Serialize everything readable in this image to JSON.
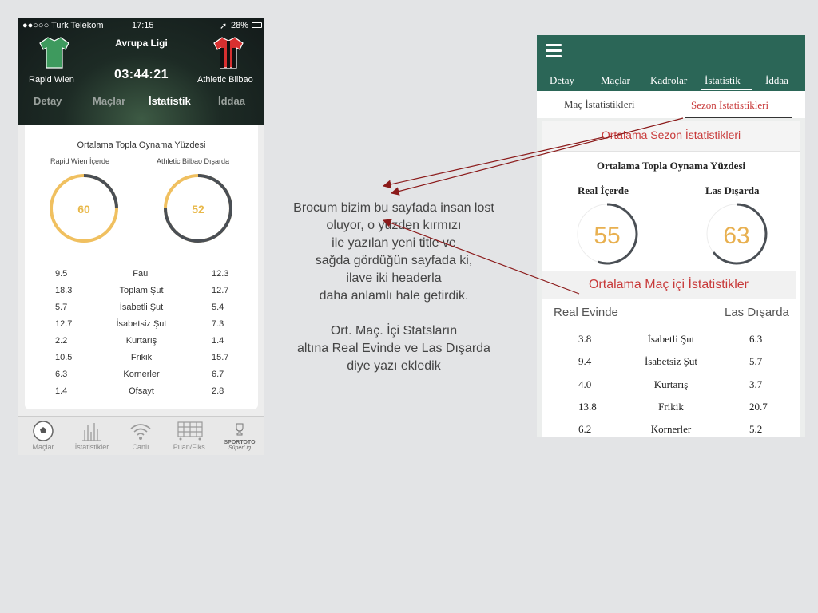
{
  "left_phone": {
    "status": {
      "carrier": "●●○○○ Turk Telekom",
      "time": "17:15",
      "battery": "28%"
    },
    "league": "Avrupa Ligi",
    "match_time": "03:44:21",
    "home_team": "Rapid Wien",
    "away_team": "Athletic Bilbao",
    "tabs": [
      "Detay",
      "Maçlar",
      "İstatistik",
      "İddaa"
    ],
    "active_tab": "İstatistik",
    "card": {
      "title": "Ortalama Topla Oynama Yüzdesi",
      "home_label": "Rapid Wien İçerde",
      "away_label": "Athletic Bilbao Dışarda",
      "home_possession": "60",
      "away_possession": "52",
      "rows": [
        {
          "home": "9.5",
          "label": "Faul",
          "away": "12.3"
        },
        {
          "home": "18.3",
          "label": "Toplam Şut",
          "away": "12.7"
        },
        {
          "home": "5.7",
          "label": "İsabetli Şut",
          "away": "5.4"
        },
        {
          "home": "12.7",
          "label": "İsabetsiz Şut",
          "away": "7.3"
        },
        {
          "home": "2.2",
          "label": "Kurtarış",
          "away": "1.4"
        },
        {
          "home": "10.5",
          "label": "Frikik",
          "away": "15.7"
        },
        {
          "home": "6.3",
          "label": "Kornerler",
          "away": "6.7"
        },
        {
          "home": "1.4",
          "label": "Ofsayt",
          "away": "2.8"
        }
      ]
    },
    "bottom_tabs": [
      "Maçlar",
      "İstatistikler",
      "Canlı",
      "Puan/Fiks."
    ],
    "sponsor": {
      "line1": "SPORTOTO",
      "line2": "SüperLig"
    }
  },
  "annotation": {
    "para1": [
      "Brocum bizim bu sayfada insan lost",
      "oluyor, o yüzden kırmızı",
      "ile yazılan yeni title ve",
      "sağda gördüğün sayfada ki,",
      "ilave iki headerla",
      "daha anlamlı hale getirdik."
    ],
    "para2": [
      "Ort. Maç. İçi Statsların",
      "altına Real Evinde ve Las Dışarda",
      "diye yazı ekledik"
    ]
  },
  "right_phone": {
    "tabs": [
      "Detay",
      "Maçlar",
      "Kadrolar",
      "İstatistik",
      "İddaa"
    ],
    "active_tab": "İstatistik",
    "subtabs": [
      "Maç İstatistikleri",
      "Sezon İstatistikleri"
    ],
    "active_subtab": "Sezon İstatistikleri",
    "section1_title": "Ortalama Sezon İstatistikleri",
    "possession_title": "Ortalama Topla Oynama Yüzdesi",
    "home_label": "Real İçerde",
    "away_label": "Las Dışarda",
    "home_possession": "55",
    "away_possession": "63",
    "section2_title": "Ortalama Maç içi İstatistikler",
    "col_home": "Real Evinde",
    "col_away": "Las Dışarda",
    "rows": [
      {
        "home": "3.8",
        "label": "İsabetli Şut",
        "away": "6.3"
      },
      {
        "home": "9.4",
        "label": "İsabetsiz Şut",
        "away": "5.7"
      },
      {
        "home": "4.0",
        "label": "Kurtarış",
        "away": "3.7"
      },
      {
        "home": "13.8",
        "label": "Frikik",
        "away": "20.7"
      },
      {
        "home": "6.2",
        "label": "Kornerler",
        "away": "5.2"
      }
    ]
  },
  "colors": {
    "accent_red": "#c83a3a",
    "header_green": "#2b6657",
    "ring_orange": "#f0c060",
    "ring_dark": "#4a4f55",
    "arrow": "#8b1a1a"
  }
}
